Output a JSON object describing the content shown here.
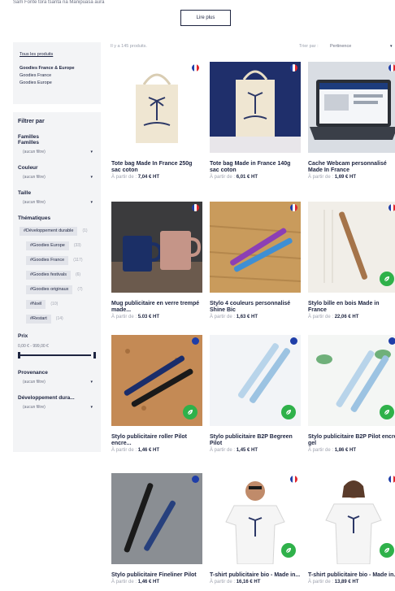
{
  "intro_text": "Sam Fonte tora tsanta na Manipuasa aura",
  "read_more": "Lire plus",
  "categories": {
    "all": "Tous les produits",
    "items": [
      "Goodies France & Europe",
      "Goodies France",
      "Goodies Europe"
    ]
  },
  "filters": {
    "title": "Filtrer par",
    "familles": {
      "label": "Familles Familles",
      "value": "(aucun filtre)"
    },
    "couleur": {
      "label": "Couleur",
      "value": "(aucun filtre)"
    },
    "taille": {
      "label": "Taille",
      "value": "(aucun filtre)"
    },
    "thematiques": {
      "label": "Thématiques",
      "tags": [
        {
          "name": "#Développement durable",
          "count": "(1)"
        },
        {
          "name": "#Goodies Europe",
          "count": "(33)"
        },
        {
          "name": "#Goodies France",
          "count": "(117)"
        },
        {
          "name": "#Goodies festivals",
          "count": "(6)"
        },
        {
          "name": "#Goodies originaux",
          "count": "(7)"
        },
        {
          "name": "#Noël",
          "count": "(10)"
        },
        {
          "name": "#Restart",
          "count": "(14)"
        }
      ]
    },
    "prix": {
      "label": "Prix",
      "range": "0,00 € - 999,00 €",
      "min_fraction": 0,
      "max_fraction": 1
    },
    "provenance": {
      "label": "Provenance",
      "value": "(aucun filtre)"
    },
    "developpement": {
      "label": "Développement dura...",
      "value": "(aucun filtre)"
    }
  },
  "toolbar": {
    "count": "Il y a 145 produits.",
    "sort_label": "Trier par :",
    "sort_value": "Pertinence"
  },
  "products": [
    {
      "name": "Tote bag Made In France 250g sac coton",
      "price_prefix": "À partir de :",
      "price": "7,04 € HT",
      "badge": "france-flag",
      "eco": false
    },
    {
      "name": "Tote bag Made in France 140g sac coton",
      "price_prefix": "À partir de :",
      "price": "6,01 € HT",
      "badge": "france-flag",
      "eco": false
    },
    {
      "name": "Cache Webcam personnalisé Made In France",
      "price_prefix": "À partir de :",
      "price": "1,69 € HT",
      "badge": "france-flag",
      "eco": false
    },
    {
      "name": "Mug publicitaire en verre trempé made...",
      "price_prefix": "À partir de :",
      "price": "5.03 € HT",
      "badge": "france-flag",
      "eco": false
    },
    {
      "name": "Stylo 4 couleurs personnalisé Shine Bic",
      "price_prefix": "À partir de :",
      "price": "1,63 € HT",
      "badge": "france-flag",
      "eco": false
    },
    {
      "name": "Stylo bille en bois Made in France",
      "price_prefix": "À partir de :",
      "price": "22,06 € HT",
      "badge": "france-flag",
      "eco": true
    },
    {
      "name": "Stylo publicitaire roller Pilot encre...",
      "price_prefix": "À partir de :",
      "price": "1,46 € HT",
      "badge": "brand-dot",
      "eco": true
    },
    {
      "name": "Stylo publicitaire B2P Begreen Pilot",
      "price_prefix": "À partir de :",
      "price": "1,45 € HT",
      "badge": "brand-dot",
      "eco": true
    },
    {
      "name": "Stylo publicitaire B2P Pilot encre gel",
      "price_prefix": "À partir de :",
      "price": "1,86 € HT",
      "badge": "brand-dot",
      "eco": true
    },
    {
      "name": "Stylo publicitaire Fineliner Pilot",
      "price_prefix": "À partir de :",
      "price": "1,46 € HT",
      "badge": "brand-dot",
      "eco": false
    },
    {
      "name": "T-shirt publicitaire bio - Made in...",
      "price_prefix": "À partir de :",
      "price": "16,16 € HT",
      "badge": "france-flag",
      "eco": true
    },
    {
      "name": "T-shirt publicitaire bio - Made in...",
      "price_prefix": "À partir de :",
      "price": "13,89 € HT",
      "badge": "france-flag",
      "eco": true
    }
  ],
  "colors": {
    "navy": "#1d2440",
    "eco_green": "#2fb14a",
    "panel": "#f3f4f6"
  }
}
